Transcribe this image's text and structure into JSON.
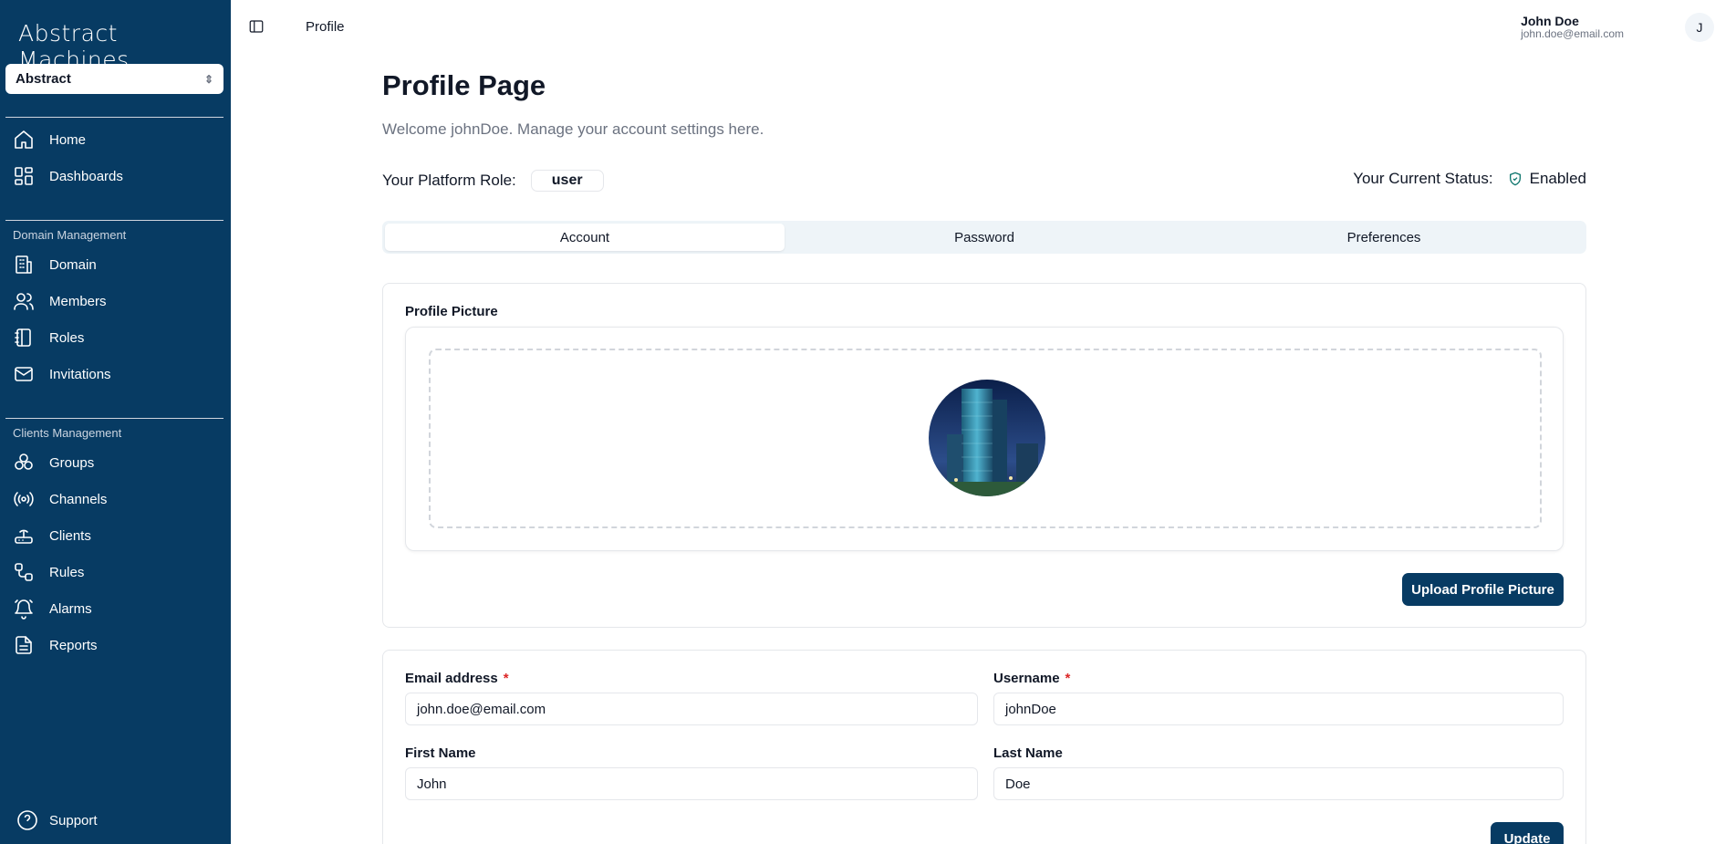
{
  "app": {
    "logo": "Abstract Machines",
    "domain_selector": "Abstract"
  },
  "sidebar": {
    "main_items": [
      {
        "label": "Home",
        "icon": "home-icon"
      },
      {
        "label": "Dashboards",
        "icon": "dashboard-icon"
      }
    ],
    "domain_section": {
      "title": "Domain Management",
      "items": [
        {
          "label": "Domain",
          "icon": "building-icon"
        },
        {
          "label": "Members",
          "icon": "users-icon"
        },
        {
          "label": "Roles",
          "icon": "notebook-icon"
        },
        {
          "label": "Invitations",
          "icon": "mail-icon"
        }
      ]
    },
    "clients_section": {
      "title": "Clients Management",
      "items": [
        {
          "label": "Groups",
          "icon": "groups-icon"
        },
        {
          "label": "Channels",
          "icon": "radio-icon"
        },
        {
          "label": "Clients",
          "icon": "router-icon"
        },
        {
          "label": "Rules",
          "icon": "workflow-icon"
        },
        {
          "label": "Alarms",
          "icon": "bell-icon"
        },
        {
          "label": "Reports",
          "icon": "file-icon"
        }
      ]
    },
    "support": "Support"
  },
  "header": {
    "breadcrumb": "Profile",
    "user_name": "John Doe",
    "user_email": "john.doe@email.com",
    "avatar_initial": "J"
  },
  "page": {
    "title": "Profile Page",
    "welcome": "Welcome johnDoe. Manage your account settings here.",
    "role_label": "Your Platform Role:",
    "role_value": "user",
    "status_label": "Your Current Status:",
    "status_value": "Enabled",
    "tabs": [
      "Account",
      "Password",
      "Preferences"
    ],
    "active_tab": "Account"
  },
  "profile_picture": {
    "label": "Profile Picture",
    "upload_button": "Upload Profile Picture"
  },
  "form": {
    "email_label": "Email address",
    "email_value": "john.doe@email.com",
    "username_label": "Username",
    "username_value": "johnDoe",
    "first_name_label": "First Name",
    "first_name_value": "John",
    "last_name_label": "Last Name",
    "last_name_value": "Doe",
    "required_mark": "*",
    "update_button": "Update"
  },
  "colors": {
    "sidebar": "#073b63",
    "primary_button": "#073b63",
    "status_icon": "#0f766e",
    "required": "#dc2626"
  }
}
